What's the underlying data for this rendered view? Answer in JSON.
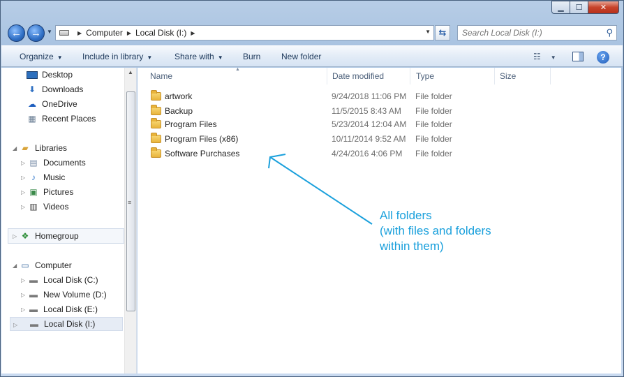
{
  "window": {
    "controls": {
      "minimize_icon": "minimize-icon",
      "maximize_icon": "maximize-icon",
      "close_icon": "close-icon"
    }
  },
  "address": {
    "crumbs": [
      "Computer",
      "Local Disk (I:)"
    ]
  },
  "search": {
    "placeholder": "Search Local Disk (I:)"
  },
  "toolbar": {
    "organize": "Organize",
    "include_in_library": "Include in library",
    "share_with": "Share with",
    "burn": "Burn",
    "new_folder": "New folder"
  },
  "nav": {
    "favorites": [
      {
        "label": "Desktop",
        "icon": "desktop-icon"
      },
      {
        "label": "Downloads",
        "icon": "downloads-icon"
      },
      {
        "label": "OneDrive",
        "icon": "onedrive-icon"
      },
      {
        "label": "Recent Places",
        "icon": "recent-places-icon"
      }
    ],
    "libraries": {
      "label": "Libraries",
      "items": [
        {
          "label": "Documents",
          "icon": "documents-icon"
        },
        {
          "label": "Music",
          "icon": "music-icon"
        },
        {
          "label": "Pictures",
          "icon": "pictures-icon"
        },
        {
          "label": "Videos",
          "icon": "videos-icon"
        }
      ]
    },
    "homegroup": {
      "label": "Homegroup"
    },
    "computer": {
      "label": "Computer",
      "drives": [
        {
          "label": "Local Disk (C:)"
        },
        {
          "label": "New Volume (D:)"
        },
        {
          "label": "Local Disk (E:)"
        },
        {
          "label": "Local Disk (I:)",
          "selected": true
        }
      ]
    }
  },
  "columns": {
    "name": "Name",
    "date": "Date modified",
    "type": "Type",
    "size": "Size"
  },
  "files": [
    {
      "name": "artwork",
      "date": "9/24/2018 11:06 PM",
      "type": "File folder"
    },
    {
      "name": "Backup",
      "date": "11/5/2015 8:43 AM",
      "type": "File folder"
    },
    {
      "name": "Program Files",
      "date": "5/23/2014 12:04 AM",
      "type": "File folder"
    },
    {
      "name": "Program Files (x86)",
      "date": "10/11/2014 9:52 AM",
      "type": "File folder"
    },
    {
      "name": "Software Purchases",
      "date": "4/24/2016 4:06 PM",
      "type": "File folder"
    }
  ],
  "annotation": {
    "lines": [
      "All folders",
      "(with files and folders",
      "within them)"
    ],
    "color": "#1aa0dc"
  }
}
